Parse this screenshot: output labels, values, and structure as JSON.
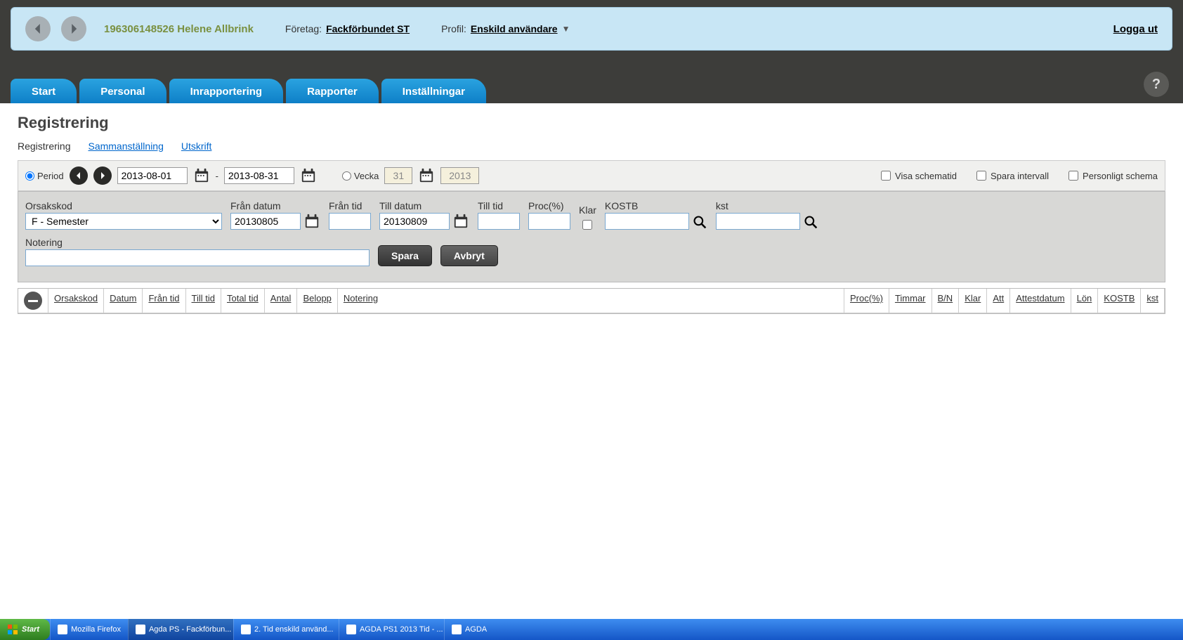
{
  "header": {
    "user_id_name": "196306148526 Helene Allbrink",
    "company_label": "Företag:",
    "company_value": "Fackförbundet ST",
    "profile_label": "Profil:",
    "profile_value": "Enskild användare",
    "logout": "Logga ut"
  },
  "tabs": [
    "Start",
    "Personal",
    "Inrapportering",
    "Rapporter",
    "Inställningar"
  ],
  "page": {
    "title": "Registrering",
    "sub_tabs": [
      "Registrering",
      "Sammanställning",
      "Utskrift"
    ]
  },
  "filter": {
    "period_label": "Period",
    "date_from": "2013-08-01",
    "date_to": "2013-08-31",
    "dash": "-",
    "week_label": "Vecka",
    "week_value": "31",
    "year_value": "2013",
    "show_schedule": "Visa schematid",
    "save_interval": "Spara intervall",
    "personal_schedule": "Personligt schema"
  },
  "form": {
    "orsakskod_label": "Orsakskod",
    "orsakskod_value": "F - Semester",
    "fran_datum_label": "Från datum",
    "fran_datum_value": "20130805",
    "fran_tid_label": "Från tid",
    "fran_tid_value": "",
    "till_datum_label": "Till datum",
    "till_datum_value": "20130809",
    "till_tid_label": "Till tid",
    "till_tid_value": "",
    "proc_label": "Proc(%)",
    "proc_value": "",
    "klar_label": "Klar",
    "kostb_label": "KOSTB",
    "kostb_value": "",
    "kst_label": "kst",
    "kst_value": "",
    "notering_label": "Notering",
    "notering_value": "",
    "save_btn": "Spara",
    "cancel_btn": "Avbryt"
  },
  "table": {
    "headers": [
      "Orsakskod",
      "Datum",
      "Från tid",
      "Till tid",
      "Total tid",
      "Antal",
      "Belopp",
      "Notering",
      "Proc(%)",
      "Timmar",
      "B/N",
      "Klar",
      "Att",
      "Attestdatum",
      "Lön",
      "KOSTB",
      "kst"
    ]
  },
  "taskbar": {
    "start": "Start",
    "items": [
      "Mozilla Firefox",
      "Agda PS - Fackförbun...",
      "2. Tid enskild använd...",
      "AGDA PS1 2013 Tid - ...",
      "AGDA"
    ]
  }
}
